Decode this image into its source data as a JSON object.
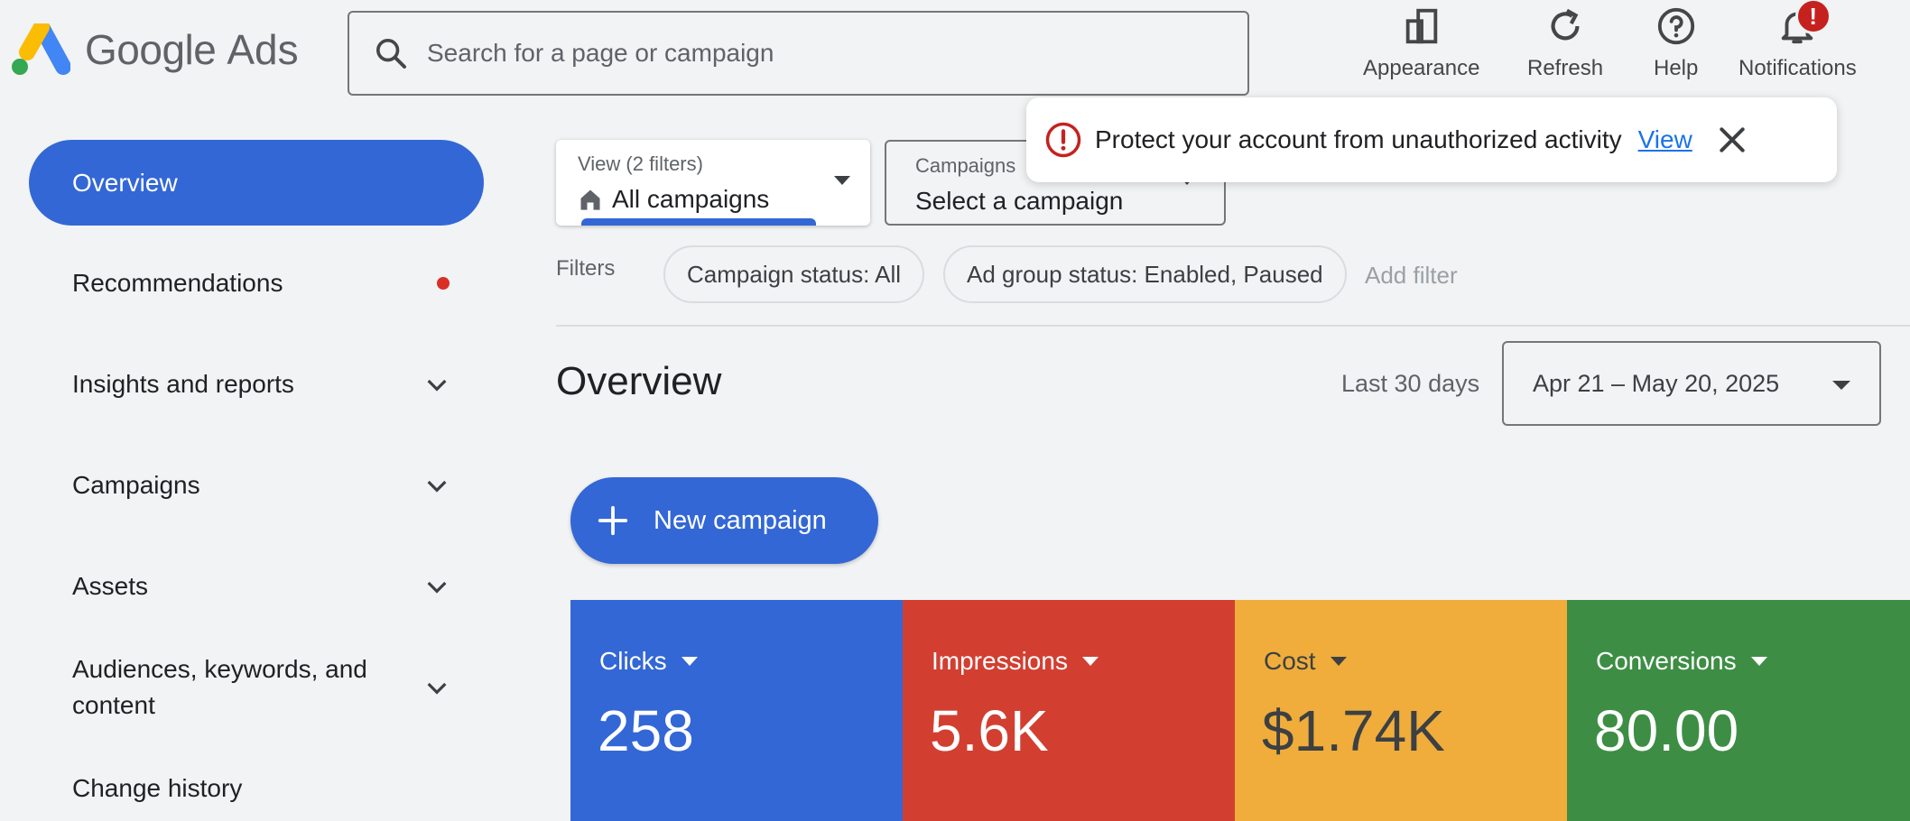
{
  "brand": {
    "google": "Google",
    "ads": "Ads"
  },
  "search": {
    "placeholder": "Search for a page or campaign"
  },
  "toolbar": {
    "appearance": "Appearance",
    "refresh": "Refresh",
    "help": "Help",
    "notifications": "Notifications",
    "notification_badge": "!"
  },
  "sidebar": {
    "items": [
      {
        "label": "Overview",
        "active": true
      },
      {
        "label": "Recommendations"
      },
      {
        "label": "Insights and reports"
      },
      {
        "label": "Campaigns"
      },
      {
        "label": "Assets"
      },
      {
        "label": "Audiences, keywords, and content"
      },
      {
        "label": "Change history"
      }
    ]
  },
  "view_selector": {
    "label": "View (2 filters)",
    "value": "All campaigns"
  },
  "campaign_selector": {
    "label": "Campaigns",
    "value": "Select a campaign"
  },
  "toast": {
    "message": "Protect your account from unauthorized activity",
    "link": "View"
  },
  "filters": {
    "label": "Filters",
    "chips": [
      "Campaign status: All",
      "Ad group status: Enabled, Paused"
    ],
    "add": "Add filter"
  },
  "overview": {
    "title": "Overview",
    "range_label": "Last 30 days",
    "date_range": "Apr 21 – May 20, 2025"
  },
  "new_campaign": {
    "label": "New campaign"
  },
  "metrics": [
    {
      "name": "Clicks",
      "value": "258",
      "color": "#3367d6"
    },
    {
      "name": "Impressions",
      "value": "5.6K",
      "color": "#d23f31"
    },
    {
      "name": "Cost",
      "value": "$1.74K",
      "color": "#f0ad3b"
    },
    {
      "name": "Conversions",
      "value": "80.00",
      "color": "#3d8e44"
    }
  ],
  "colors": {
    "accent": "#3367d6",
    "alert": "#c5221f",
    "link": "#1a73e8"
  }
}
